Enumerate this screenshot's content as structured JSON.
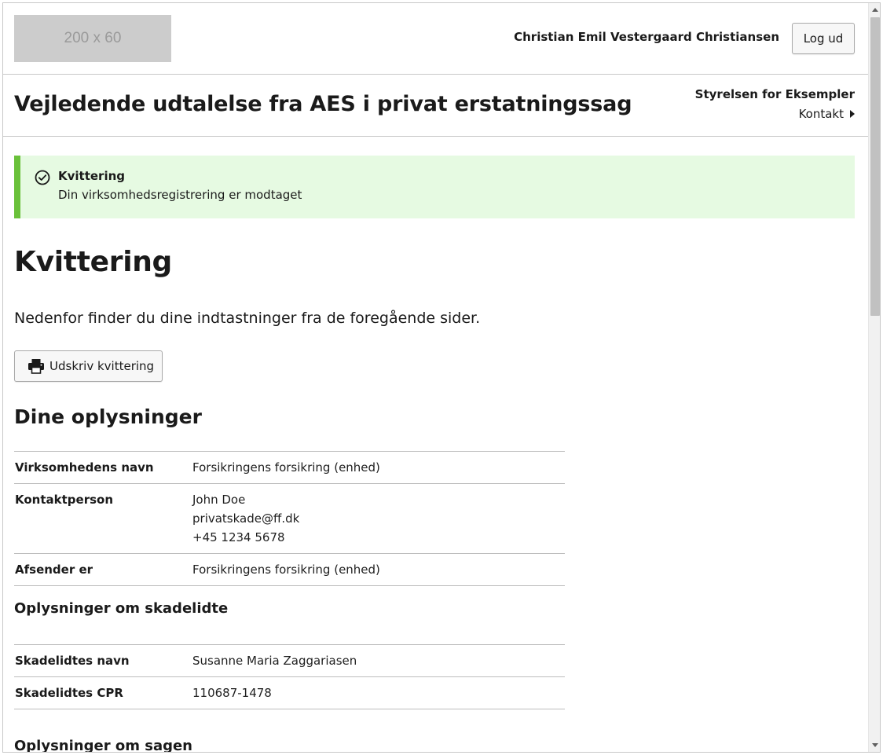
{
  "header": {
    "logo_text": "200 x 60",
    "user_name": "Christian Emil Vestergaard Christiansen",
    "logout_label": "Log ud"
  },
  "titlebar": {
    "title": "Vejledende udtalelse fra AES i privat erstatningssag",
    "authority": "Styrelsen for Eksempler",
    "contact_label": "Kontakt"
  },
  "alert": {
    "title": "Kvittering",
    "text": "Din virksomhedsregistrering er modtaget",
    "icon": "check-circle-icon",
    "bg_color": "#e6fae2",
    "accent_color": "#6ac13a"
  },
  "main": {
    "heading": "Kvittering",
    "intro": "Nedenfor finder du dine indtastninger fra de foregående sider.",
    "print_label": "Udskriv kvittering",
    "print_icon": "print-icon",
    "section1": {
      "heading": "Dine oplysninger",
      "rows": [
        {
          "key": "Virksomhedens navn",
          "values": [
            "Forsikringens forsikring (enhed)"
          ]
        },
        {
          "key": "Kontaktperson",
          "values": [
            "John Doe",
            "privatskade@ff.dk",
            "+45 1234 5678"
          ]
        },
        {
          "key": "Afsender er",
          "values": [
            "Forsikringens forsikring (enhed)"
          ]
        }
      ]
    },
    "section2": {
      "heading": "Oplysninger om skadelidte",
      "rows": [
        {
          "key": "Skadelidtes navn",
          "values": [
            "Susanne Maria Zaggariasen"
          ]
        },
        {
          "key": "Skadelidtes CPR",
          "values": [
            "110687-1478"
          ]
        }
      ]
    },
    "section3": {
      "heading": "Oplysninger om sagen"
    }
  }
}
